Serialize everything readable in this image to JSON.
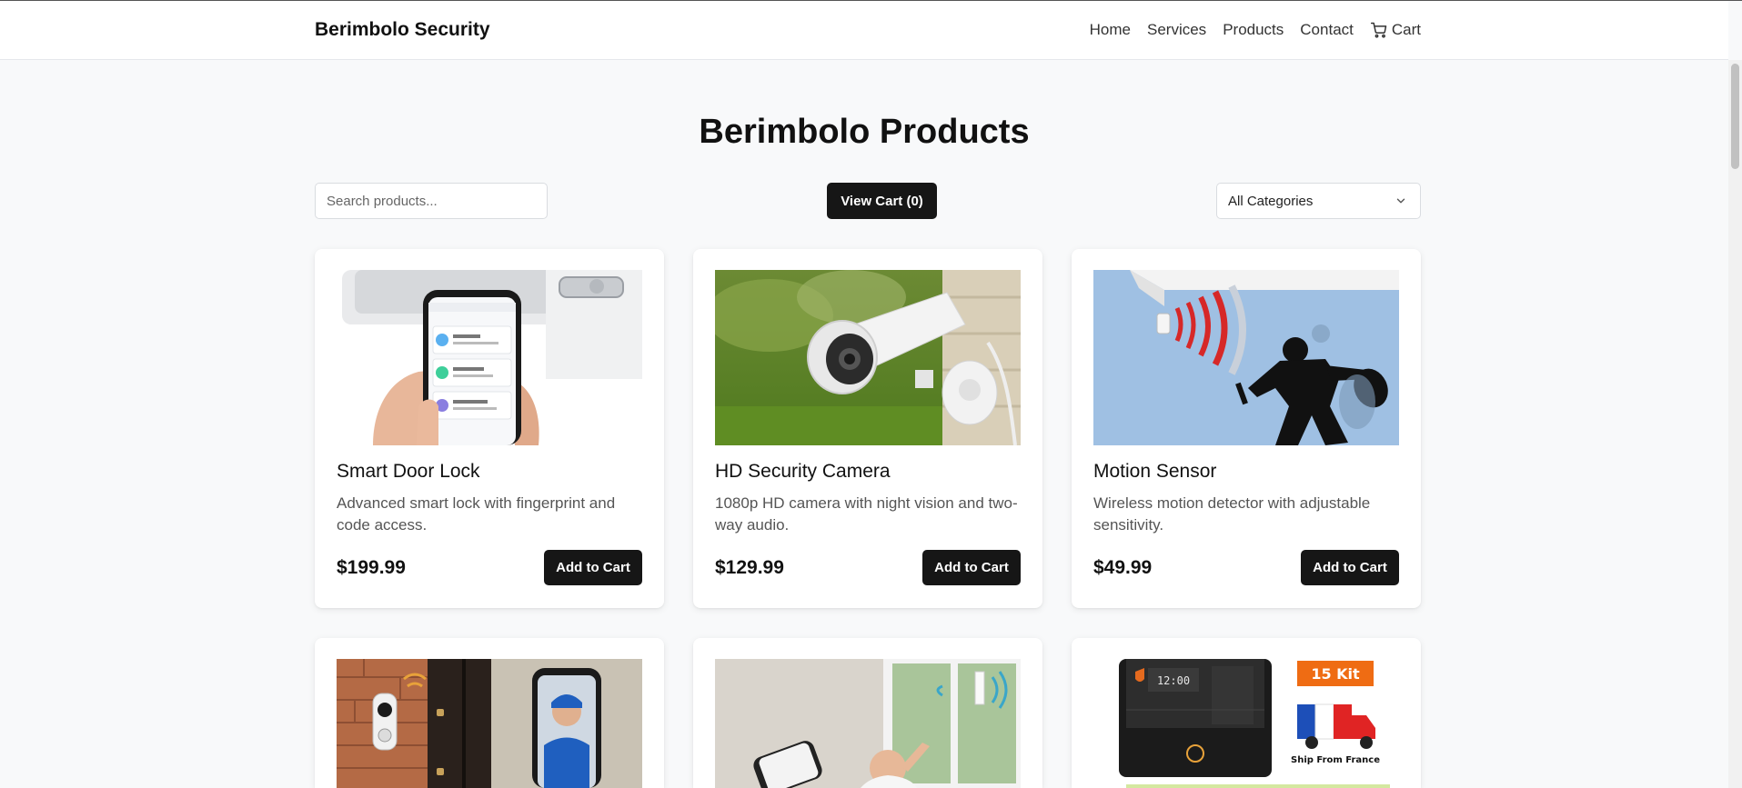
{
  "header": {
    "brand": "Berimbolo Security",
    "nav": [
      {
        "label": "Home"
      },
      {
        "label": "Services"
      },
      {
        "label": "Products"
      },
      {
        "label": "Contact"
      },
      {
        "label": "Cart",
        "icon": "cart-icon"
      }
    ]
  },
  "page": {
    "title": "Berimbolo Products",
    "search_placeholder": "Search products...",
    "view_cart_label": "View Cart (0)",
    "category_selected": "All Categories"
  },
  "products": [
    {
      "name": "Smart Door Lock",
      "description": "Advanced smart lock with fingerprint and code access.",
      "price": "$199.99",
      "button": "Add to Cart",
      "image": "smart-door-lock-image"
    },
    {
      "name": "HD Security Camera",
      "description": "1080p HD camera with night vision and two-way audio.",
      "price": "$129.99",
      "button": "Add to Cart",
      "image": "security-camera-image"
    },
    {
      "name": "Motion Sensor",
      "description": "Wireless motion detector with adjustable sensitivity.",
      "price": "$49.99",
      "button": "Add to Cart",
      "image": "motion-sensor-image"
    },
    {
      "image": "video-doorbell-image"
    },
    {
      "image": "window-sensor-image"
    },
    {
      "image": "alarm-kit-image",
      "image_text": [
        "15 Kit",
        "Ship From France",
        "12:00"
      ]
    }
  ],
  "colors": {
    "accent": "#161616",
    "background": "#f8f9fa",
    "kit_badge": "#ef6c13"
  }
}
